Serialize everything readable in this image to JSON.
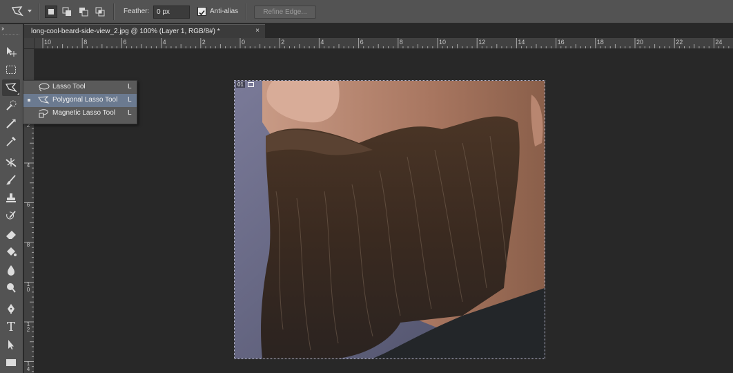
{
  "options_bar": {
    "feather_label": "Feather:",
    "feather_value": "0 px",
    "antialias_label": "Anti-alias",
    "antialias_checked": true,
    "refine_edge_label": "Refine Edge..."
  },
  "toolbar": {
    "collapse_glyph": "››",
    "tools": [
      {
        "name": "move-tool",
        "icon": "move-icon"
      },
      {
        "name": "rectangular-marquee-tool",
        "icon": "marquee-icon"
      },
      {
        "name": "polygonal-lasso-tool",
        "icon": "polygonal-lasso-icon",
        "active": true
      },
      {
        "name": "quick-selection-tool",
        "icon": "quick-selection-icon"
      },
      {
        "name": "crop-tool",
        "icon": "crop-icon"
      },
      {
        "name": "eyedropper-tool",
        "icon": "eyedropper-icon"
      },
      {
        "name": "healing-brush-tool",
        "icon": "healing-icon"
      },
      {
        "name": "brush-tool",
        "icon": "brush-icon"
      },
      {
        "name": "clone-stamp-tool",
        "icon": "stamp-icon"
      },
      {
        "name": "history-brush-tool",
        "icon": "history-brush-icon"
      },
      {
        "name": "eraser-tool",
        "icon": "eraser-icon"
      },
      {
        "name": "paint-bucket-tool",
        "icon": "bucket-icon"
      },
      {
        "name": "blur-tool",
        "icon": "blur-icon"
      },
      {
        "name": "dodge-tool",
        "icon": "dodge-icon"
      },
      {
        "name": "pen-tool",
        "icon": "pen-icon"
      },
      {
        "name": "type-tool",
        "icon": "type-icon",
        "glyph": "T"
      },
      {
        "name": "path-selection-tool",
        "icon": "path-select-icon"
      },
      {
        "name": "rectangle-tool",
        "icon": "rectangle-icon"
      }
    ]
  },
  "document": {
    "tab_title": "long-cool-beard-side-view_2.jpg @ 100% (Layer 1, RGB/8#) *",
    "close_glyph": "×",
    "layer_badge": "01"
  },
  "ruler_top": [
    "10",
    "8",
    "6",
    "4",
    "2",
    "0",
    "2",
    "4",
    "6",
    "8",
    "10",
    "12",
    "14",
    "16",
    "18",
    "20",
    "22",
    "24"
  ],
  "ruler_left": [
    "2",
    "4",
    "6",
    "8",
    "10",
    "12",
    "14"
  ],
  "flyout": {
    "items": [
      {
        "label": "Lasso Tool",
        "shortcut": "L",
        "icon": "lasso-icon",
        "selected": false
      },
      {
        "label": "Polygonal Lasso Tool",
        "shortcut": "L",
        "icon": "polygonal-lasso-icon",
        "selected": true
      },
      {
        "label": "Magnetic Lasso Tool",
        "shortcut": "L",
        "icon": "magnetic-lasso-icon",
        "selected": false
      }
    ]
  },
  "colors": {
    "ui_panel": "#535353",
    "canvas_bg": "#282828",
    "menu_highlight": "#6b7a90"
  }
}
